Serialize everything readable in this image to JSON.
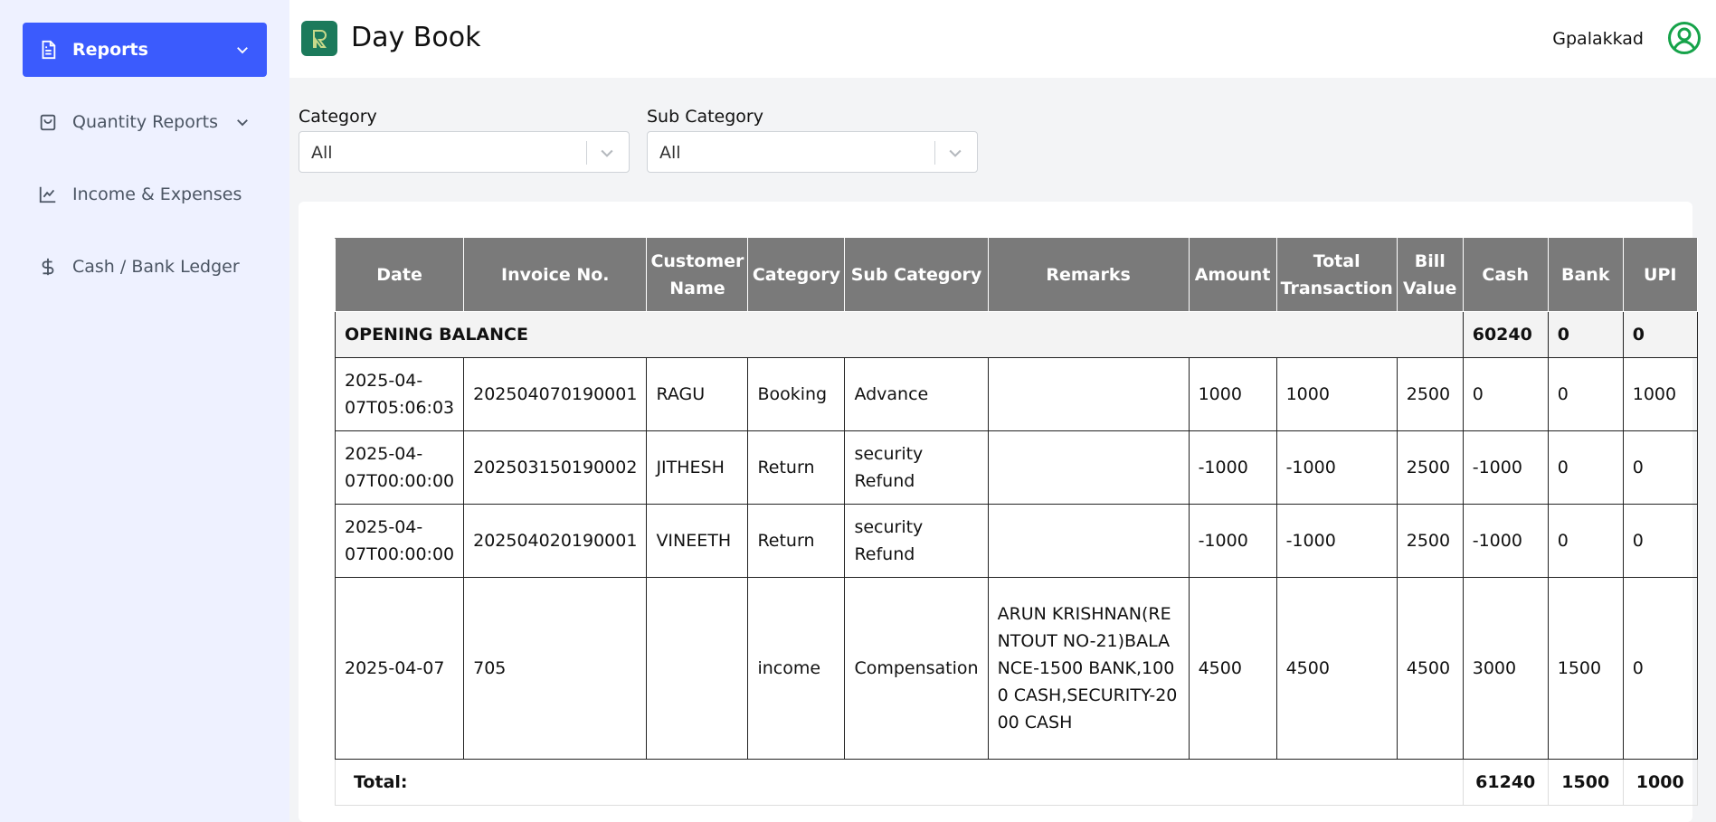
{
  "sidebar": {
    "items": [
      {
        "label": "Reports",
        "icon": "document-icon",
        "active": true
      },
      {
        "label": "Quantity Reports",
        "icon": "shopping-bag-icon"
      },
      {
        "label": "Income & Expenses",
        "icon": "line-chart-icon"
      },
      {
        "label": "Cash / Bank Ledger",
        "icon": "dollar-icon"
      }
    ]
  },
  "header": {
    "title": "Day Book",
    "username": "Gpalakkad"
  },
  "filters": {
    "category": {
      "label": "Category",
      "value": "All"
    },
    "sub_category": {
      "label": "Sub Category",
      "value": "All"
    }
  },
  "table": {
    "columns": [
      "Date",
      "Invoice No.",
      "Customer Name",
      "Category",
      "Sub Category",
      "Remarks",
      "Amount",
      "Total Transaction",
      "Bill Value",
      "Cash",
      "Bank",
      "UPI"
    ],
    "opening": {
      "label": "OPENING BALANCE",
      "cash": "60240",
      "bank": "0",
      "upi": "0"
    },
    "rows": [
      {
        "date": "2025-04-07T05:06:03",
        "invoice": "202504070190001",
        "customer": "RAGU",
        "category": "Booking",
        "sub_category": "Advance",
        "remarks": "",
        "amount": "1000",
        "total": "1000",
        "bill": "2500",
        "cash": "0",
        "bank": "0",
        "upi": "1000"
      },
      {
        "date": "2025-04-07T00:00:00",
        "invoice": "202503150190002",
        "customer": "JITHESH",
        "category": "Return",
        "sub_category": "security Refund",
        "remarks": "",
        "amount": "-1000",
        "total": "-1000",
        "bill": "2500",
        "cash": "-1000",
        "bank": "0",
        "upi": "0"
      },
      {
        "date": "2025-04-07T00:00:00",
        "invoice": "202504020190001",
        "customer": "VINEETH",
        "category": "Return",
        "sub_category": "security Refund",
        "remarks": "",
        "amount": "-1000",
        "total": "-1000",
        "bill": "2500",
        "cash": "-1000",
        "bank": "0",
        "upi": "0"
      },
      {
        "date": "2025-04-07",
        "invoice": "705",
        "customer": "",
        "category": "income",
        "sub_category": "Compensation",
        "remarks": "ARUN KRISHNAN(RENTOUT NO-21)BALANCE-1500 BANK,1000 CASH,SECURITY-2000 CASH",
        "amount": "4500",
        "total": "4500",
        "bill": "4500",
        "cash": "3000",
        "bank": "1500",
        "upi": "0"
      }
    ],
    "total": {
      "label": "Total:",
      "cash": "61240",
      "bank": "1500",
      "upi": "1000"
    }
  },
  "colors": {
    "accent": "#3b5bfd",
    "header_bg": "#7a7a7a",
    "logo": "#1c7a5b",
    "avatar": "#16a34a"
  }
}
